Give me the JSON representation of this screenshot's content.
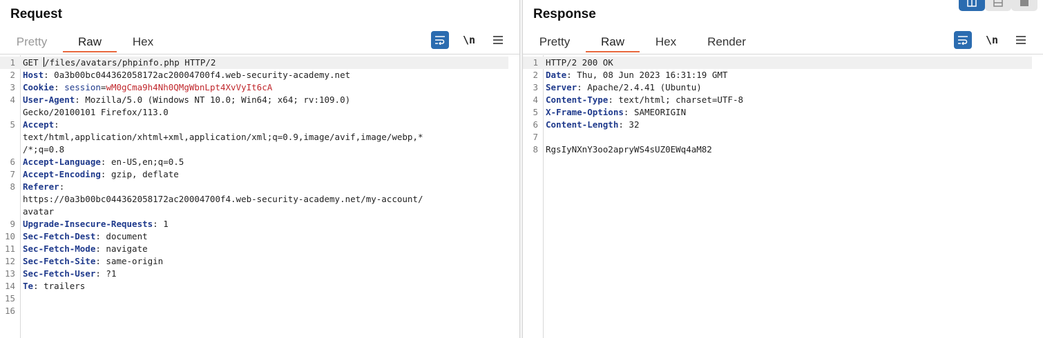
{
  "request": {
    "title": "Request",
    "tabs": [
      {
        "label": "Pretty",
        "state": "disabled"
      },
      {
        "label": "Raw",
        "state": "active"
      },
      {
        "label": "Hex",
        "state": "normal"
      }
    ],
    "lines": [
      {
        "n": "1",
        "method": "GET ",
        "rest": "/files/avatars/phpinfo.php HTTP/2"
      },
      {
        "n": "2",
        "key": "Host",
        "value": "0a3b00bc044362058172ac20004700f4.web-security-academy.net"
      },
      {
        "n": "3",
        "key": "Cookie",
        "cookie_name": "session",
        "cookie_value": "wM0gCma9h4Nh0QMgWbnLpt4XvVyIt6cA"
      },
      {
        "n": "4",
        "key": "User-Agent",
        "value": "Mozilla/5.0 (Windows NT 10.0; Win64; x64; rv:109.0)"
      },
      {
        "n": "",
        "cont": "Gecko/20100101 Firefox/113.0"
      },
      {
        "n": "5",
        "key": "Accept",
        "value": ""
      },
      {
        "n": "",
        "cont": "text/html,application/xhtml+xml,application/xml;q=0.9,image/avif,image/webp,*"
      },
      {
        "n": "",
        "cont": "/*;q=0.8"
      },
      {
        "n": "6",
        "key": "Accept-Language",
        "value": "en-US,en;q=0.5"
      },
      {
        "n": "7",
        "key": "Accept-Encoding",
        "value": "gzip, deflate"
      },
      {
        "n": "8",
        "key": "Referer",
        "value": ""
      },
      {
        "n": "",
        "cont": "https://0a3b00bc044362058172ac20004700f4.web-security-academy.net/my-account/"
      },
      {
        "n": "",
        "cont": "avatar"
      },
      {
        "n": "9",
        "key": "Upgrade-Insecure-Requests",
        "value": "1"
      },
      {
        "n": "10",
        "key": "Sec-Fetch-Dest",
        "value": "document"
      },
      {
        "n": "11",
        "key": "Sec-Fetch-Mode",
        "value": "navigate"
      },
      {
        "n": "12",
        "key": "Sec-Fetch-Site",
        "value": "same-origin"
      },
      {
        "n": "13",
        "key": "Sec-Fetch-User",
        "value": "?1"
      },
      {
        "n": "14",
        "key": "Te",
        "value": "trailers"
      },
      {
        "n": "15",
        "cont": ""
      },
      {
        "n": "16",
        "cont": ""
      }
    ]
  },
  "response": {
    "title": "Response",
    "tabs": [
      {
        "label": "Pretty",
        "state": "normal"
      },
      {
        "label": "Raw",
        "state": "active"
      },
      {
        "label": "Hex",
        "state": "normal"
      },
      {
        "label": "Render",
        "state": "normal"
      }
    ],
    "lines": [
      {
        "n": "1",
        "cont": "HTTP/2 200 OK"
      },
      {
        "n": "2",
        "key": "Date",
        "value": "Thu, 08 Jun 2023 16:31:19 GMT"
      },
      {
        "n": "3",
        "key": "Server",
        "value": "Apache/2.4.41 (Ubuntu)"
      },
      {
        "n": "4",
        "key": "Content-Type",
        "value": "text/html; charset=UTF-8"
      },
      {
        "n": "5",
        "key": "X-Frame-Options",
        "value": "SAMEORIGIN"
      },
      {
        "n": "6",
        "key": "Content-Length",
        "value": "32"
      },
      {
        "n": "7",
        "cont": ""
      },
      {
        "n": "8",
        "cont": "RgsIyNXnY3oo2apryWS4sUZ0EWq4aM82"
      }
    ]
  },
  "toolbar": {
    "newline_label": "\\n",
    "icons": [
      "wrap-lines-icon",
      "newline-icon",
      "menu-icon"
    ]
  },
  "layout_buttons": [
    "split-horizontal-icon",
    "split-vertical-icon",
    "single-pane-icon"
  ],
  "colors": {
    "accent": "#e8673c",
    "header_key": "#1f3a8c",
    "cookie_value": "#c0282d",
    "button_blue": "#2b6cb0"
  }
}
